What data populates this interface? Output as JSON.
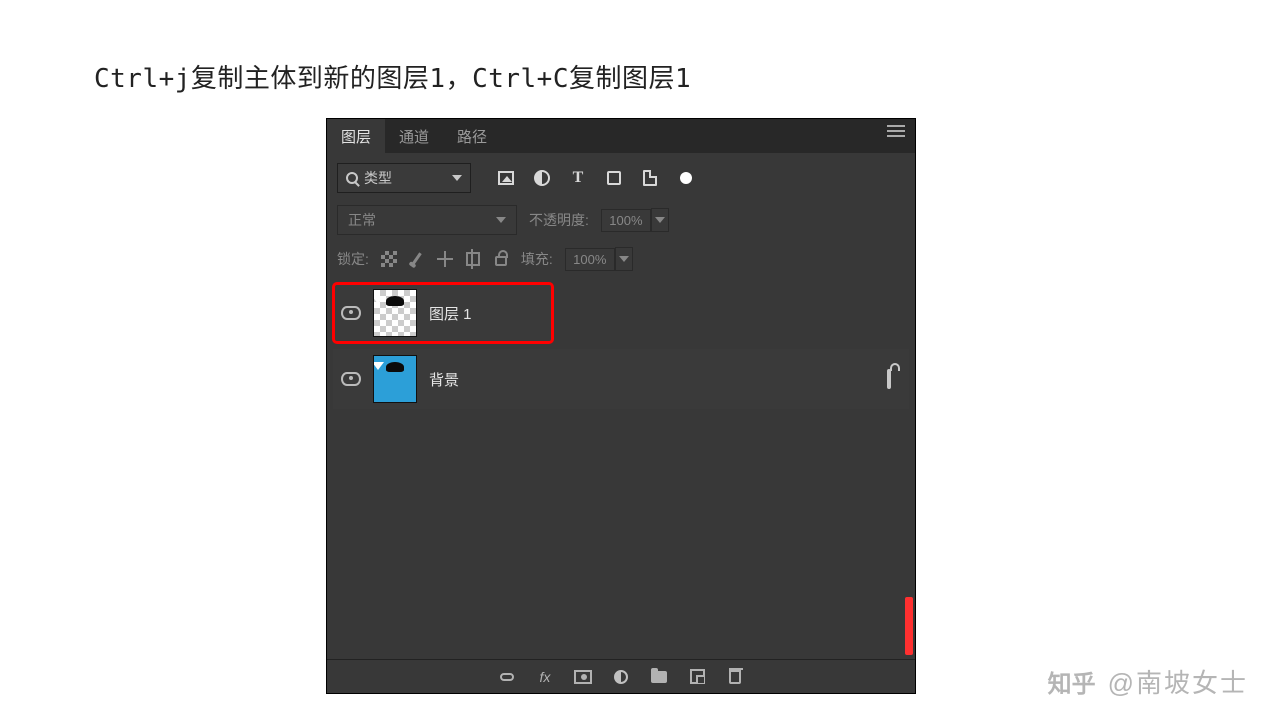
{
  "instruction": "Ctrl+j复制主体到新的图层1，Ctrl+C复制图层1",
  "panel": {
    "tabs": [
      {
        "label": "图层",
        "active": true
      },
      {
        "label": "通道",
        "active": false
      },
      {
        "label": "路径",
        "active": false
      }
    ],
    "filter": {
      "type_label": "类型"
    },
    "blend": {
      "mode": "正常",
      "opacity_label": "不透明度:",
      "opacity_value": "100%"
    },
    "lock": {
      "label": "锁定:",
      "fill_label": "填充:",
      "fill_value": "100%"
    },
    "layers": [
      {
        "name": "图层 1",
        "visible": true,
        "thumb": "transparent_person",
        "selected": true,
        "locked": false
      },
      {
        "name": "背景",
        "visible": true,
        "thumb": "blue_person",
        "selected": false,
        "locked": true
      }
    ]
  },
  "watermark": {
    "site": "知乎",
    "author": "@南坡女士"
  }
}
